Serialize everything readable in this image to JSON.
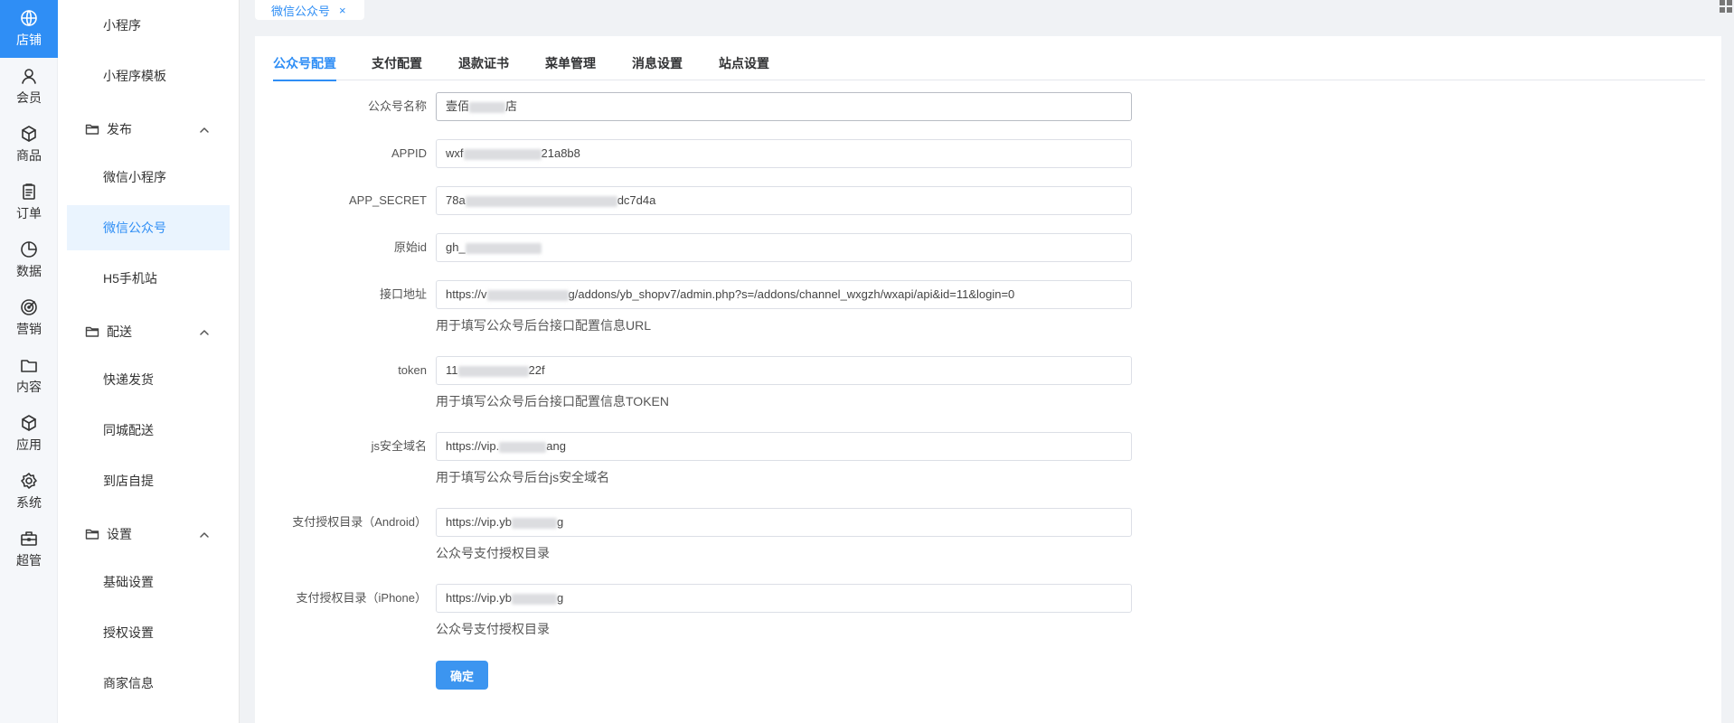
{
  "rail": {
    "items": [
      {
        "label": "店铺",
        "icon": "store-icon"
      },
      {
        "label": "会员",
        "icon": "member-icon"
      },
      {
        "label": "商品",
        "icon": "goods-icon"
      },
      {
        "label": "订单",
        "icon": "order-icon"
      },
      {
        "label": "数据",
        "icon": "data-icon"
      },
      {
        "label": "营销",
        "icon": "marketing-icon"
      },
      {
        "label": "内容",
        "icon": "content-icon"
      },
      {
        "label": "应用",
        "icon": "app-icon"
      },
      {
        "label": "系统",
        "icon": "system-icon"
      },
      {
        "label": "超管",
        "icon": "admin-icon"
      }
    ]
  },
  "subnav": {
    "top_items": [
      "小程序",
      "小程序模板"
    ],
    "groups": [
      {
        "title": "发布",
        "items": [
          "微信小程序",
          "微信公众号",
          "H5手机站"
        ]
      },
      {
        "title": "配送",
        "items": [
          "快递发货",
          "同城配送",
          "到店自提"
        ]
      },
      {
        "title": "设置",
        "items": [
          "基础设置",
          "授权设置",
          "商家信息"
        ]
      }
    ]
  },
  "page_tab": {
    "label": "微信公众号",
    "close": "×"
  },
  "tabs": [
    "公众号配置",
    "支付配置",
    "退款证书",
    "菜单管理",
    "消息设置",
    "站点设置"
  ],
  "form": {
    "fields": [
      {
        "label": "公众号名称",
        "value_pre": "壹佰",
        "value_post": "店",
        "hint": ""
      },
      {
        "label": "APPID",
        "value_pre": "wxf",
        "value_post": "21a8b8",
        "hint": ""
      },
      {
        "label": "APP_SECRET",
        "value_pre": "78a",
        "value_post": "dc7d4a",
        "hint": ""
      },
      {
        "label": "原始id",
        "value_pre": "gh_",
        "value_post": "",
        "hint": ""
      },
      {
        "label": "接口地址",
        "value_pre": "https://v",
        "value_post": "g/addons/yb_shopv7/admin.php?s=/addons/channel_wxgzh/wxapi/api&id=11&login=0",
        "hint": "用于填写公众号后台接口配置信息URL"
      },
      {
        "label": "token",
        "value_pre": "11",
        "value_post": "22f",
        "hint": "用于填写公众号后台接口配置信息TOKEN"
      },
      {
        "label": "js安全域名",
        "value_pre": "https://vip.",
        "value_post": "ang",
        "hint": "用于填写公众号后台js安全域名"
      },
      {
        "label": "支付授权目录（Android）",
        "value_pre": "https://vip.yb",
        "value_post": "g",
        "hint": "公众号支付授权目录"
      },
      {
        "label": "支付授权目录（iPhone）",
        "value_pre": "https://vip.yb",
        "value_post": "g",
        "hint": "公众号支付授权目录"
      }
    ],
    "submit_label": "确定"
  },
  "colors": {
    "accent": "#2f8ef5",
    "accent_soft": "#eaf4fe",
    "notch": "#f5a04c"
  }
}
